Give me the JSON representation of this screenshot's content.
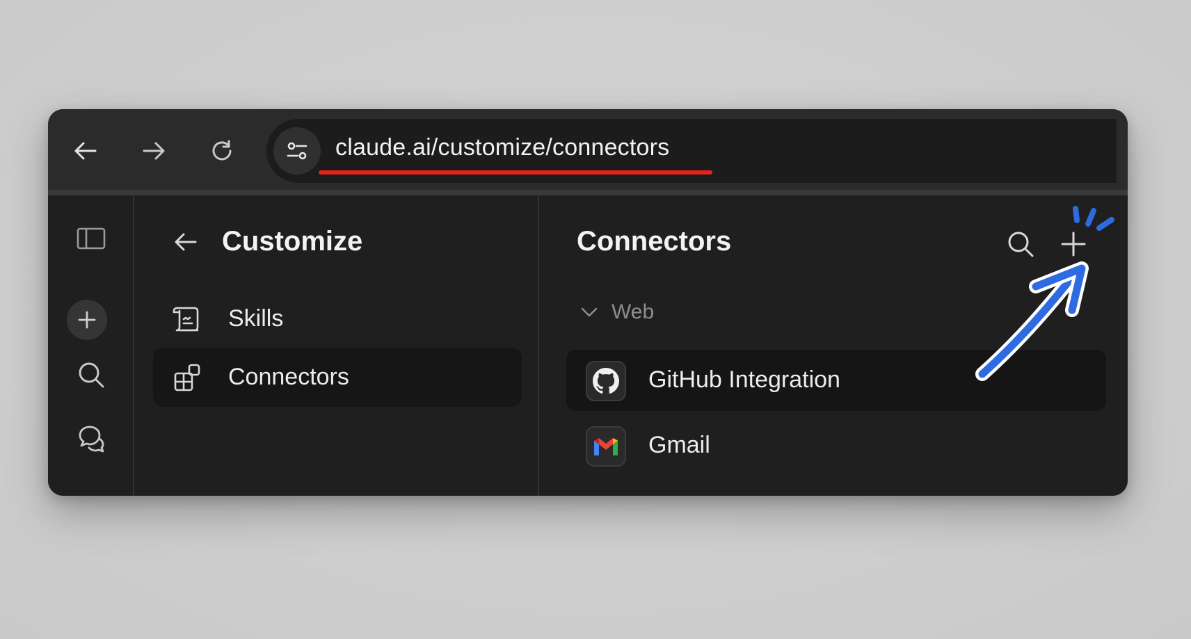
{
  "browser": {
    "url": "claude.ai/customize/connectors",
    "icons": {
      "back": "arrow-left-icon",
      "forward": "arrow-right-icon",
      "reload": "reload-icon",
      "site_settings": "tune-icon"
    },
    "url_highlight_color": "#e5231d"
  },
  "rail": {
    "icons": [
      "sidebar-toggle-icon",
      "plus-icon",
      "search-icon",
      "chats-icon"
    ]
  },
  "customize_panel": {
    "title": "Customize",
    "items": [
      {
        "label": "Skills",
        "icon": "skills-icon",
        "selected": false
      },
      {
        "label": "Connectors",
        "icon": "connectors-icon",
        "selected": true
      }
    ]
  },
  "connectors_panel": {
    "title": "Connectors",
    "group": "Web",
    "connectors": [
      {
        "label": "GitHub Integration",
        "icon": "github-icon",
        "highlighted": true
      },
      {
        "label": "Gmail",
        "icon": "gmail-icon",
        "highlighted": false
      }
    ]
  },
  "annotation": {
    "arrow_color": "#2f6be0",
    "target": "add-connector-button"
  }
}
